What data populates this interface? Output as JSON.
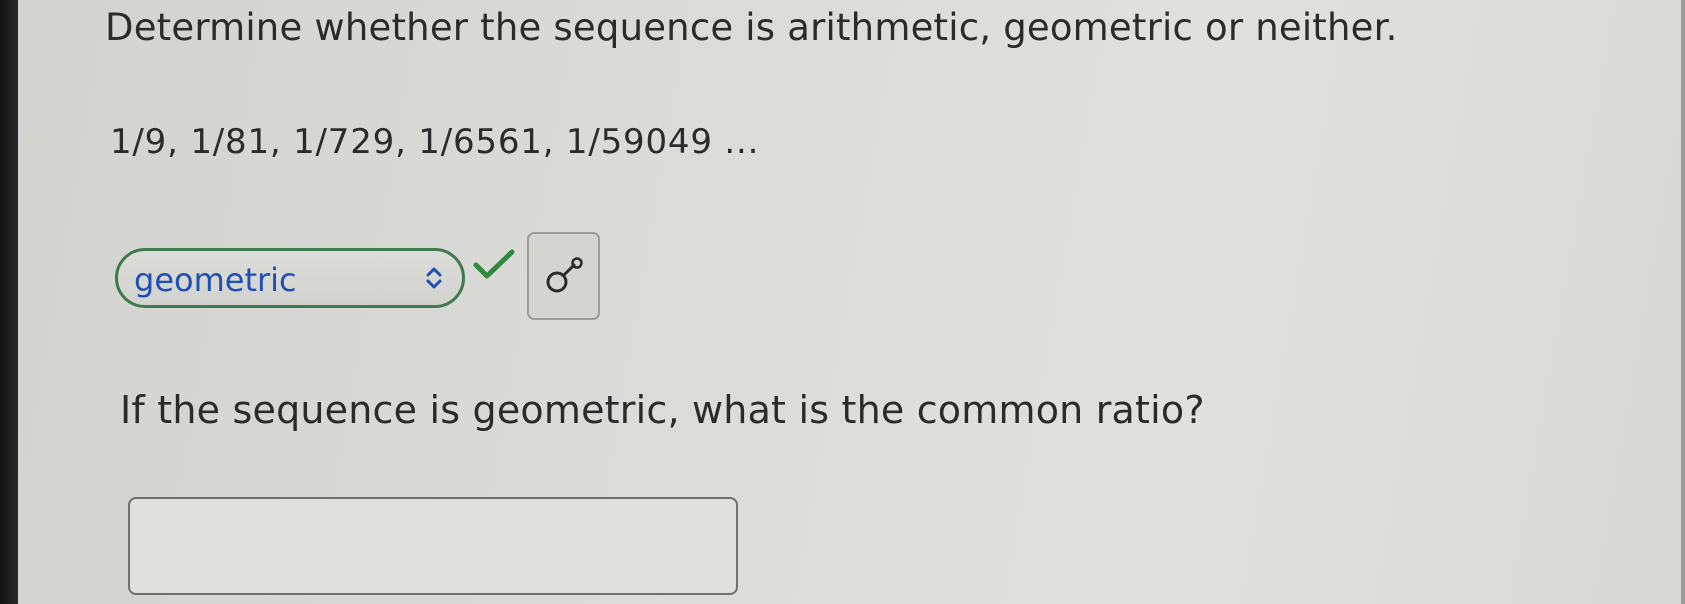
{
  "problem": {
    "instruction": "Determine whether the sequence is arithmetic, geometric or neither.",
    "sequence": "1/9, 1/81, 1/729, 1/6561, 1/59049 ..."
  },
  "classification_select": {
    "selected": "geometric",
    "status": "correct",
    "status_icon": "check-icon",
    "accent_color": "#3e7a4d",
    "value_color": "#1d4fb5"
  },
  "tool_button": {
    "icon": "math-tool-icon"
  },
  "follow_up": {
    "question": "If the sequence is geometric, what is the common ratio?",
    "answer_value": ""
  }
}
